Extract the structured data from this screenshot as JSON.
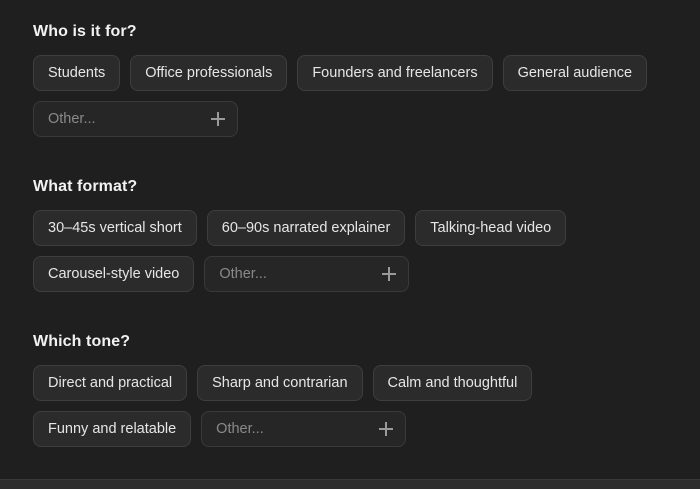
{
  "audience": {
    "title": "Who is it for?",
    "options": [
      "Students",
      "Office professionals",
      "Founders and freelancers",
      "General audience"
    ],
    "other_placeholder": "Other..."
  },
  "format": {
    "title": "What format?",
    "options": [
      "30–45s vertical short",
      "60–90s narrated explainer",
      "Talking-head video",
      "Carousel-style video"
    ],
    "other_placeholder": "Other..."
  },
  "tone": {
    "title": "Which tone?",
    "options": [
      "Direct and practical",
      "Sharp and contrarian",
      "Calm and thoughtful",
      "Funny and relatable"
    ],
    "other_placeholder": "Other..."
  },
  "colors": {
    "background": "#1f1f1f",
    "chip_background": "#2b2b2b",
    "chip_border": "#3e3e3e",
    "text": "#e6e6e6"
  },
  "icons": {
    "add": "plus-icon"
  }
}
